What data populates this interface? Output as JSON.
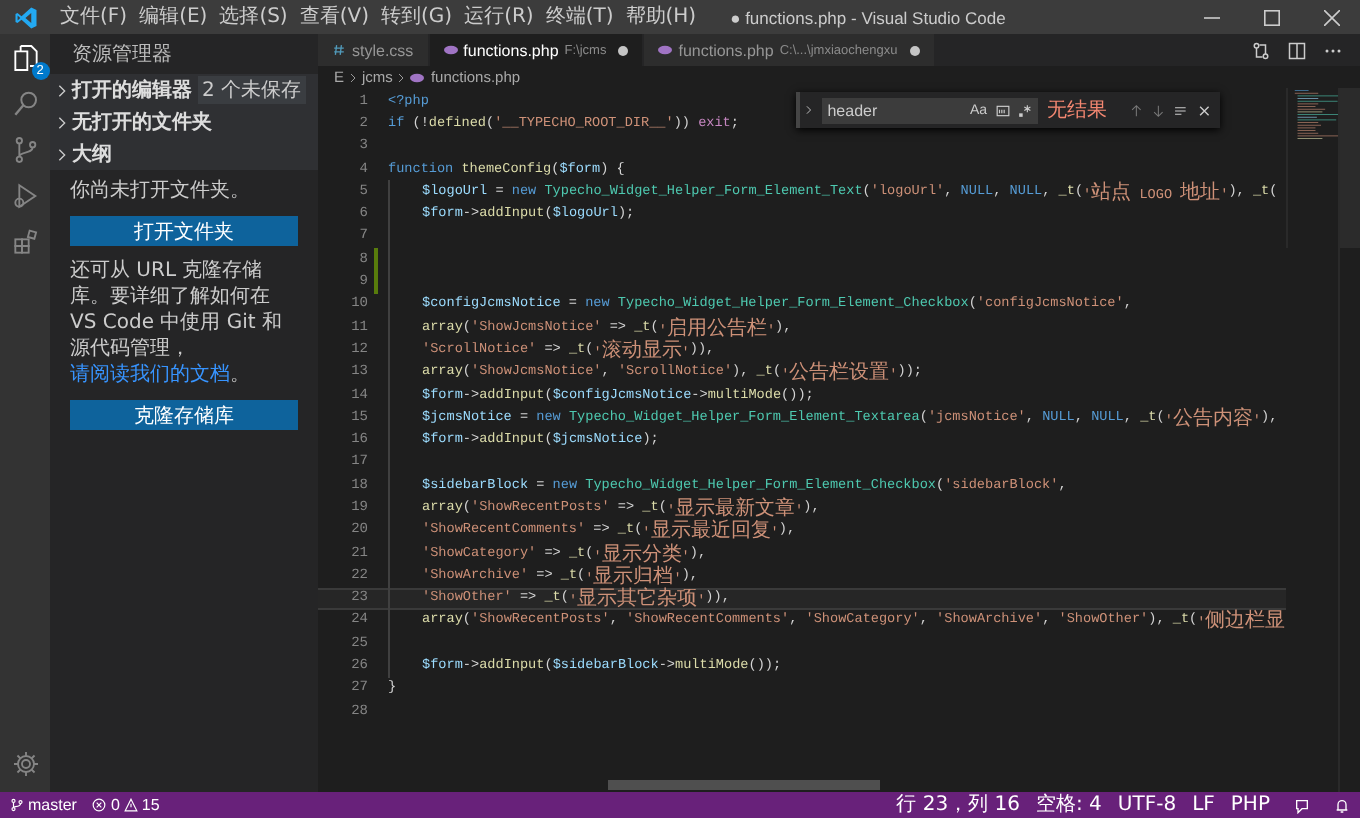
{
  "window": {
    "title": "● functions.php - Visual Studio Code"
  },
  "menu": [
    "文件(F)",
    "编辑(E)",
    "选择(S)",
    "查看(V)",
    "转到(G)",
    "运行(R)",
    "终端(T)",
    "帮助(H)"
  ],
  "activity_bar": {
    "explorer_badge": "2"
  },
  "sidebar": {
    "title": "资源管理器",
    "sections": [
      {
        "label": "打开的编辑器",
        "badge": "2 个未保存"
      },
      {
        "label": "无打开的文件夹"
      },
      {
        "label": "大纲"
      }
    ],
    "message": "你尚未打开文件夹。",
    "open_button": "打开文件夹",
    "clone_text": "还可从 URL 克隆存储库。要详细了解如何在 VS Code 中使用 Git 和源代码管理，",
    "clone_link": "请阅读我们的文档",
    "clone_text_end": "。",
    "clone_button": "克隆存储库"
  },
  "tabs": [
    {
      "label": "style.css",
      "kind": "css",
      "modified": false,
      "selected": false
    },
    {
      "label": "functions.php",
      "kind": "php",
      "path": "F:\\jcms",
      "modified": true,
      "selected": true
    },
    {
      "label": "functions.php",
      "kind": "php",
      "path": "C:\\...\\jmxiaochengxu",
      "modified": true,
      "selected": false
    }
  ],
  "breadcrumb": [
    "E",
    "jcms",
    "functions.php"
  ],
  "find": {
    "value": "header",
    "case_toggle": "Aa",
    "result": "无结果"
  },
  "code": [
    {
      "number": "1",
      "indented": false,
      "changed": false,
      "selected": false,
      "tokens": [
        {
          "kind": "tag",
          "text": "<?php"
        }
      ]
    },
    {
      "number": "2",
      "indented": false,
      "changed": false,
      "selected": false,
      "tokens": [
        {
          "kind": "keyword",
          "text": "if"
        },
        {
          "kind": "plain",
          "text": " (!"
        },
        {
          "kind": "function",
          "text": "defined"
        },
        {
          "kind": "plain",
          "text": "("
        },
        {
          "kind": "string",
          "text": "'__TYPECHO_ROOT_DIR__'"
        },
        {
          "kind": "plain",
          "text": ")) "
        },
        {
          "kind": "control",
          "text": "exit"
        },
        {
          "kind": "plain",
          "text": ";"
        }
      ]
    },
    {
      "number": "3",
      "indented": false,
      "changed": false,
      "selected": false
    },
    {
      "number": "4",
      "indented": false,
      "changed": false,
      "selected": false,
      "tokens": [
        {
          "kind": "keyword",
          "text": "function "
        },
        {
          "kind": "function",
          "text": "themeConfig"
        },
        {
          "kind": "plain",
          "text": "("
        },
        {
          "kind": "variable",
          "text": "$form"
        },
        {
          "kind": "plain",
          "text": ") {"
        }
      ]
    },
    {
      "number": "5",
      "indented": true,
      "changed": false,
      "selected": false,
      "tokens": [
        {
          "kind": "variable",
          "text": "$logoUrl"
        },
        {
          "kind": "plain",
          "text": " = "
        },
        {
          "kind": "keyword",
          "text": "new "
        },
        {
          "kind": "class",
          "text": "Typecho_Widget_Helper_Form_Element_Text"
        },
        {
          "kind": "plain",
          "text": "("
        },
        {
          "kind": "string",
          "text": "'logoUrl'"
        },
        {
          "kind": "plain",
          "text": ", "
        },
        {
          "kind": "keyword",
          "text": "NULL"
        },
        {
          "kind": "plain",
          "text": ", "
        },
        {
          "kind": "keyword",
          "text": "NULL"
        },
        {
          "kind": "plain",
          "text": ", "
        },
        {
          "kind": "function",
          "text": "_t"
        },
        {
          "kind": "plain",
          "text": "("
        },
        {
          "kind": "string",
          "text": "'站点 LOGO 地址'"
        },
        {
          "kind": "plain",
          "text": "), "
        },
        {
          "kind": "function",
          "text": "_t"
        },
        {
          "kind": "plain",
          "text": "("
        }
      ]
    },
    {
      "number": "6",
      "indented": true,
      "changed": false,
      "selected": false,
      "tokens": [
        {
          "kind": "variable",
          "text": "$form"
        },
        {
          "kind": "plain",
          "text": "->"
        },
        {
          "kind": "function",
          "text": "addInput"
        },
        {
          "kind": "plain",
          "text": "("
        },
        {
          "kind": "variable",
          "text": "$logoUrl"
        },
        {
          "kind": "plain",
          "text": ");"
        }
      ]
    },
    {
      "number": "7",
      "indented": true,
      "changed": false,
      "selected": false
    },
    {
      "number": "8",
      "indented": true,
      "changed": true,
      "selected": false
    },
    {
      "number": "9",
      "indented": true,
      "changed": true,
      "selected": false
    },
    {
      "number": "10",
      "indented": true,
      "changed": false,
      "selected": false,
      "tokens": [
        {
          "kind": "variable",
          "text": "$configJcmsNotice"
        },
        {
          "kind": "plain",
          "text": " = "
        },
        {
          "kind": "keyword",
          "text": "new "
        },
        {
          "kind": "class",
          "text": "Typecho_Widget_Helper_Form_Element_Checkbox"
        },
        {
          "kind": "plain",
          "text": "("
        },
        {
          "kind": "string",
          "text": "'configJcmsNotice'"
        },
        {
          "kind": "plain",
          "text": ","
        }
      ]
    },
    {
      "number": "11",
      "indented": true,
      "changed": false,
      "selected": false,
      "tokens": [
        {
          "kind": "function",
          "text": "array"
        },
        {
          "kind": "plain",
          "text": "("
        },
        {
          "kind": "string",
          "text": "'ShowJcmsNotice'"
        },
        {
          "kind": "plain",
          "text": " => "
        },
        {
          "kind": "function",
          "text": "_t"
        },
        {
          "kind": "plain",
          "text": "("
        },
        {
          "kind": "string",
          "text": "'启用公告栏'"
        },
        {
          "kind": "plain",
          "text": "),"
        }
      ]
    },
    {
      "number": "12",
      "indented": true,
      "changed": false,
      "selected": false,
      "tokens": [
        {
          "kind": "string",
          "text": "'ScrollNotice'"
        },
        {
          "kind": "plain",
          "text": " => "
        },
        {
          "kind": "function",
          "text": "_t"
        },
        {
          "kind": "plain",
          "text": "("
        },
        {
          "kind": "string",
          "text": "'滚动显示'"
        },
        {
          "kind": "plain",
          "text": ")),"
        }
      ]
    },
    {
      "number": "13",
      "indented": true,
      "changed": false,
      "selected": false,
      "tokens": [
        {
          "kind": "function",
          "text": "array"
        },
        {
          "kind": "plain",
          "text": "("
        },
        {
          "kind": "string",
          "text": "'ShowJcmsNotice'"
        },
        {
          "kind": "plain",
          "text": ", "
        },
        {
          "kind": "string",
          "text": "'ScrollNotice'"
        },
        {
          "kind": "plain",
          "text": "), "
        },
        {
          "kind": "function",
          "text": "_t"
        },
        {
          "kind": "plain",
          "text": "("
        },
        {
          "kind": "string",
          "text": "'公告栏设置'"
        },
        {
          "kind": "plain",
          "text": "));"
        }
      ]
    },
    {
      "number": "14",
      "indented": true,
      "changed": false,
      "selected": false,
      "tokens": [
        {
          "kind": "variable",
          "text": "$form"
        },
        {
          "kind": "plain",
          "text": "->"
        },
        {
          "kind": "function",
          "text": "addInput"
        },
        {
          "kind": "plain",
          "text": "("
        },
        {
          "kind": "variable",
          "text": "$configJcmsNotice"
        },
        {
          "kind": "plain",
          "text": "->"
        },
        {
          "kind": "function",
          "text": "multiMode"
        },
        {
          "kind": "plain",
          "text": "());"
        }
      ]
    },
    {
      "number": "15",
      "indented": true,
      "changed": false,
      "selected": false,
      "tokens": [
        {
          "kind": "variable",
          "text": "$jcmsNotice"
        },
        {
          "kind": "plain",
          "text": " = "
        },
        {
          "kind": "keyword",
          "text": "new "
        },
        {
          "kind": "class",
          "text": "Typecho_Widget_Helper_Form_Element_Textarea"
        },
        {
          "kind": "plain",
          "text": "("
        },
        {
          "kind": "string",
          "text": "'jcmsNotice'"
        },
        {
          "kind": "plain",
          "text": ", "
        },
        {
          "kind": "keyword",
          "text": "NULL"
        },
        {
          "kind": "plain",
          "text": ", "
        },
        {
          "kind": "keyword",
          "text": "NULL"
        },
        {
          "kind": "plain",
          "text": ", "
        },
        {
          "kind": "function",
          "text": "_t"
        },
        {
          "kind": "plain",
          "text": "("
        },
        {
          "kind": "string",
          "text": "'公告内容'"
        },
        {
          "kind": "plain",
          "text": "),"
        }
      ]
    },
    {
      "number": "16",
      "indented": true,
      "changed": false,
      "selected": false,
      "tokens": [
        {
          "kind": "variable",
          "text": "$form"
        },
        {
          "kind": "plain",
          "text": "->"
        },
        {
          "kind": "function",
          "text": "addInput"
        },
        {
          "kind": "plain",
          "text": "("
        },
        {
          "kind": "variable",
          "text": "$jcmsNotice"
        },
        {
          "kind": "plain",
          "text": ");"
        }
      ]
    },
    {
      "number": "17",
      "indented": true,
      "changed": false,
      "selected": false
    },
    {
      "number": "18",
      "indented": true,
      "changed": false,
      "selected": false,
      "tokens": [
        {
          "kind": "variable",
          "text": "$sidebarBlock"
        },
        {
          "kind": "plain",
          "text": " = "
        },
        {
          "kind": "keyword",
          "text": "new "
        },
        {
          "kind": "class",
          "text": "Typecho_Widget_Helper_Form_Element_Checkbox"
        },
        {
          "kind": "plain",
          "text": "("
        },
        {
          "kind": "string",
          "text": "'sidebarBlock'"
        },
        {
          "kind": "plain",
          "text": ","
        }
      ]
    },
    {
      "number": "19",
      "indented": true,
      "changed": false,
      "selected": false,
      "tokens": [
        {
          "kind": "function",
          "text": "array"
        },
        {
          "kind": "plain",
          "text": "("
        },
        {
          "kind": "string",
          "text": "'ShowRecentPosts'"
        },
        {
          "kind": "plain",
          "text": " => "
        },
        {
          "kind": "function",
          "text": "_t"
        },
        {
          "kind": "plain",
          "text": "("
        },
        {
          "kind": "string",
          "text": "'显示最新文章'"
        },
        {
          "kind": "plain",
          "text": "),"
        }
      ]
    },
    {
      "number": "20",
      "indented": true,
      "changed": false,
      "selected": false,
      "tokens": [
        {
          "kind": "string",
          "text": "'ShowRecentComments'"
        },
        {
          "kind": "plain",
          "text": " => "
        },
        {
          "kind": "function",
          "text": "_t"
        },
        {
          "kind": "plain",
          "text": "("
        },
        {
          "kind": "string",
          "text": "'显示最近回复'"
        },
        {
          "kind": "plain",
          "text": "),"
        }
      ]
    },
    {
      "number": "21",
      "indented": true,
      "changed": false,
      "selected": false,
      "tokens": [
        {
          "kind": "string",
          "text": "'ShowCategory'"
        },
        {
          "kind": "plain",
          "text": " => "
        },
        {
          "kind": "function",
          "text": "_t"
        },
        {
          "kind": "plain",
          "text": "("
        },
        {
          "kind": "string",
          "text": "'显示分类'"
        },
        {
          "kind": "plain",
          "text": "),"
        }
      ]
    },
    {
      "number": "22",
      "indented": true,
      "changed": false,
      "selected": false,
      "tokens": [
        {
          "kind": "string",
          "text": "'ShowArchive'"
        },
        {
          "kind": "plain",
          "text": " => "
        },
        {
          "kind": "function",
          "text": "_t"
        },
        {
          "kind": "plain",
          "text": "("
        },
        {
          "kind": "string",
          "text": "'显示归档'"
        },
        {
          "kind": "plain",
          "text": "),"
        }
      ]
    },
    {
      "number": "23",
      "indented": true,
      "changed": false,
      "selected": true,
      "tokens": [
        {
          "kind": "string",
          "text": "'ShowOther'"
        },
        {
          "kind": "plain",
          "text": " => "
        },
        {
          "kind": "function",
          "text": "_t"
        },
        {
          "kind": "plain",
          "text": "("
        },
        {
          "kind": "string",
          "text": "'显示其它杂项'"
        },
        {
          "kind": "plain",
          "text": ")),"
        }
      ]
    },
    {
      "number": "24",
      "indented": true,
      "changed": false,
      "selected": false,
      "tokens": [
        {
          "kind": "function",
          "text": "array"
        },
        {
          "kind": "plain",
          "text": "("
        },
        {
          "kind": "string",
          "text": "'ShowRecentPosts'"
        },
        {
          "kind": "plain",
          "text": ", "
        },
        {
          "kind": "string",
          "text": "'ShowRecentComments'"
        },
        {
          "kind": "plain",
          "text": ", "
        },
        {
          "kind": "string",
          "text": "'ShowCategory'"
        },
        {
          "kind": "plain",
          "text": ", "
        },
        {
          "kind": "string",
          "text": "'ShowArchive'"
        },
        {
          "kind": "plain",
          "text": ", "
        },
        {
          "kind": "string",
          "text": "'ShowOther'"
        },
        {
          "kind": "plain",
          "text": "), "
        },
        {
          "kind": "function",
          "text": "_t"
        },
        {
          "kind": "plain",
          "text": "("
        },
        {
          "kind": "string",
          "text": "'侧边栏显"
        }
      ]
    },
    {
      "number": "25",
      "indented": true,
      "changed": false,
      "selected": false
    },
    {
      "number": "26",
      "indented": true,
      "changed": false,
      "selected": false,
      "tokens": [
        {
          "kind": "variable",
          "text": "$form"
        },
        {
          "kind": "plain",
          "text": "->"
        },
        {
          "kind": "function",
          "text": "addInput"
        },
        {
          "kind": "plain",
          "text": "("
        },
        {
          "kind": "variable",
          "text": "$sidebarBlock"
        },
        {
          "kind": "plain",
          "text": "->"
        },
        {
          "kind": "function",
          "text": "multiMode"
        },
        {
          "kind": "plain",
          "text": "());"
        }
      ]
    },
    {
      "number": "27",
      "indented": false,
      "changed": false,
      "selected": false,
      "tokens": [
        {
          "kind": "plain",
          "text": "}"
        }
      ]
    },
    {
      "number": "28",
      "indented": false,
      "changed": false,
      "selected": false
    }
  ],
  "status_bar": {
    "branch": "master",
    "errors": "0",
    "warnings": "15",
    "position": "行 23，列 16",
    "indent": "空格: 4",
    "encoding": "UTF-8",
    "eol": "LF",
    "language": "PHP"
  }
}
